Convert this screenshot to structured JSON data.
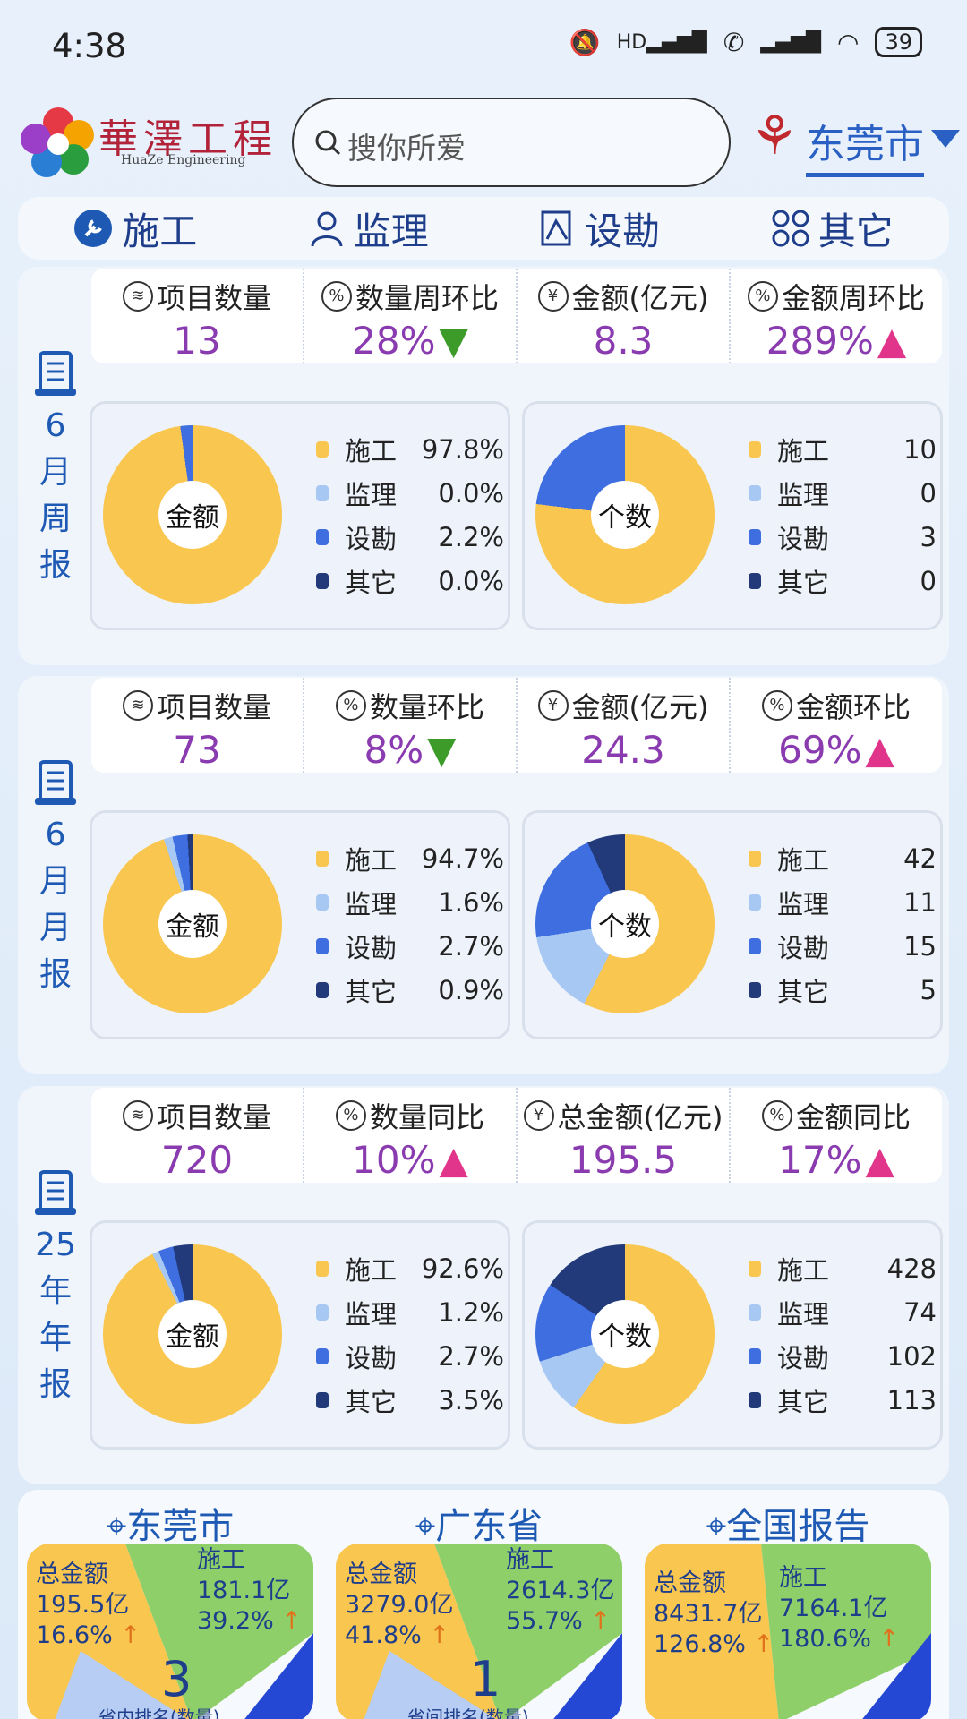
{
  "status": {
    "time": "4:38",
    "battery": "39",
    "hd": "HD"
  },
  "header": {
    "logo_title": "華澤工程",
    "logo_sub": "HuaZe  Engineering",
    "search_placeholder": "搜你所爱",
    "city": "东莞市"
  },
  "tabs": [
    {
      "label": "施工",
      "icon": "wrench-icon"
    },
    {
      "label": "监理",
      "icon": "person-icon"
    },
    {
      "label": "设勘",
      "icon": "survey-icon"
    },
    {
      "label": "其它",
      "icon": "grid-icon"
    }
  ],
  "colors": {
    "construction": "#f9c64f",
    "supervision": "#a8c8f4",
    "survey": "#3f6ee0",
    "other": "#223a7a"
  },
  "legend_names": [
    "施工",
    "监理",
    "设勘",
    "其它"
  ],
  "donut_labels": {
    "amount": "金额",
    "count": "个数"
  },
  "reports": [
    {
      "side": [
        "6",
        "月",
        "周",
        "报"
      ],
      "stats": [
        {
          "label": "项目数量",
          "value": "13",
          "icon": "layers-icon"
        },
        {
          "label": "数量周环比",
          "value": "28%",
          "trend": "down",
          "icon": "percent-icon"
        },
        {
          "label": "金额(亿元)",
          "value": "8.3",
          "icon": "yen-icon"
        },
        {
          "label": "金额周环比",
          "value": "289%",
          "trend": "up",
          "icon": "percent-icon"
        }
      ],
      "amount_pct": [
        "97.8%",
        "0.0%",
        "2.2%",
        "0.0%"
      ],
      "amount_values": [
        97.8,
        0.0,
        2.2,
        0.0
      ],
      "counts": [
        "10",
        "0",
        "3",
        "0"
      ],
      "count_values": [
        10,
        0,
        3,
        0
      ]
    },
    {
      "side": [
        "6",
        "月",
        "月",
        "报"
      ],
      "stats": [
        {
          "label": "项目数量",
          "value": "73",
          "icon": "layers-icon"
        },
        {
          "label": "数量环比",
          "value": "8%",
          "trend": "down",
          "icon": "percent-icon"
        },
        {
          "label": "金额(亿元)",
          "value": "24.3",
          "icon": "yen-icon"
        },
        {
          "label": "金额环比",
          "value": "69%",
          "trend": "up",
          "icon": "percent-icon"
        }
      ],
      "amount_pct": [
        "94.7%",
        "1.6%",
        "2.7%",
        "0.9%"
      ],
      "amount_values": [
        94.7,
        1.6,
        2.7,
        0.9
      ],
      "counts": [
        "42",
        "11",
        "15",
        "5"
      ],
      "count_values": [
        42,
        11,
        15,
        5
      ]
    },
    {
      "side": [
        "25",
        "年",
        "年",
        "报"
      ],
      "stats": [
        {
          "label": "项目数量",
          "value": "720",
          "icon": "layers-icon"
        },
        {
          "label": "数量同比",
          "value": "10%",
          "trend": "up",
          "icon": "percent-icon"
        },
        {
          "label": "总金额(亿元)",
          "value": "195.5",
          "icon": "yen-icon"
        },
        {
          "label": "金额同比",
          "value": "17%",
          "trend": "up",
          "icon": "percent-icon"
        }
      ],
      "amount_pct": [
        "92.6%",
        "1.2%",
        "2.7%",
        "3.5%"
      ],
      "amount_values": [
        92.6,
        1.2,
        2.7,
        3.5
      ],
      "counts": [
        "428",
        "74",
        "102",
        "113"
      ],
      "count_values": [
        428,
        74,
        102,
        113
      ]
    }
  ],
  "regions": [
    {
      "title": "东莞市",
      "total_label": "总金额",
      "total": "195.5亿",
      "total_pct": "16.6%",
      "sg_label": "施工",
      "sg_amount": "181.1亿",
      "sg_pct": "39.2%",
      "rank": "3",
      "rank_label": "省内排名(数量)"
    },
    {
      "title": "广东省",
      "total_label": "总金额",
      "total": "3279.0亿",
      "total_pct": "41.8%",
      "sg_label": "施工",
      "sg_amount": "2614.3亿",
      "sg_pct": "55.7%",
      "rank": "1",
      "rank_label": "省间排名(数量)"
    },
    {
      "title": "全国报告",
      "total_label": "总金额",
      "total": "8431.7亿",
      "total_pct": "126.8%",
      "sg_label": "施工",
      "sg_amount": "7164.1亿",
      "sg_pct": "180.6%",
      "rank": "",
      "rank_label": ""
    }
  ]
}
